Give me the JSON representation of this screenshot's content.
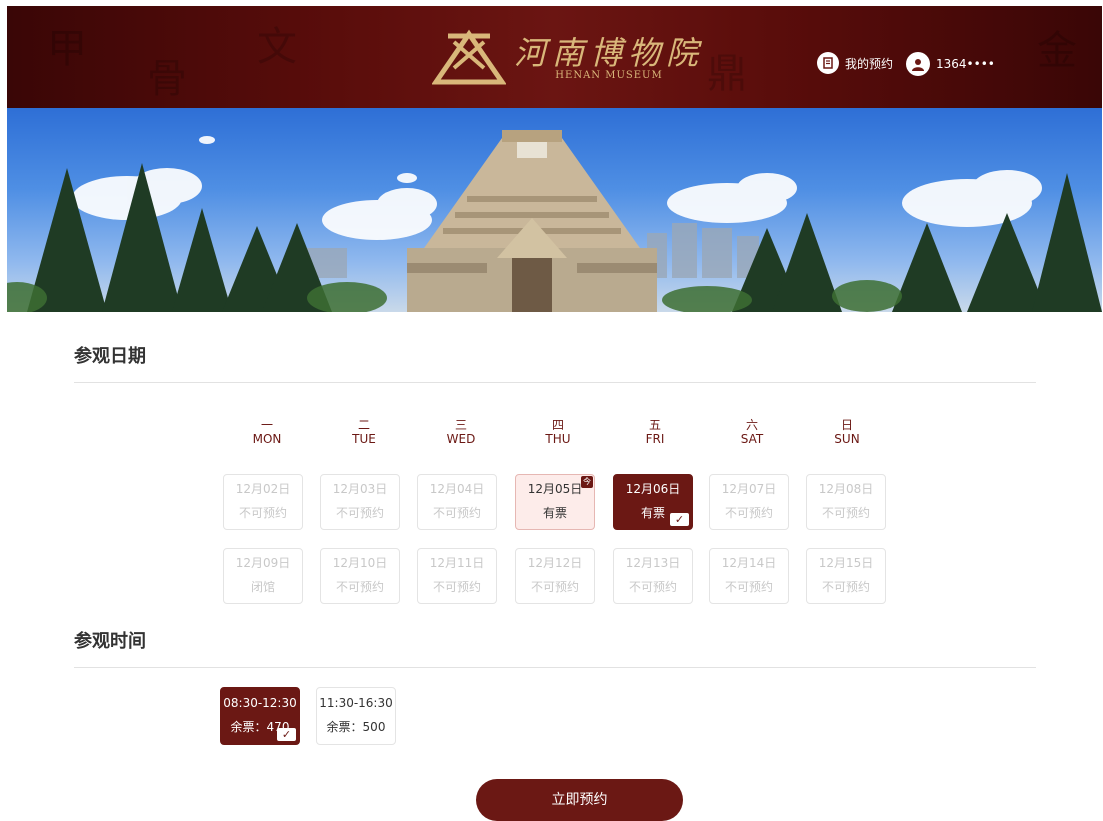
{
  "header": {
    "logo_cn": "河南博物院",
    "logo_en": "HENAN MUSEUM",
    "my_booking": "我的预约",
    "user": "1364••••",
    "icons": [
      "booking-icon",
      "user-icon"
    ],
    "background": "#5a0d0b"
  },
  "colors": {
    "accent": "#6b1814",
    "available_bg": "#fdecea",
    "muted": "#c8c8c8"
  },
  "date_section": {
    "title": "参观日期",
    "weekdays": [
      {
        "cn": "一",
        "en": "MON"
      },
      {
        "cn": "二",
        "en": "TUE"
      },
      {
        "cn": "三",
        "en": "WED"
      },
      {
        "cn": "四",
        "en": "THU"
      },
      {
        "cn": "五",
        "en": "FRI"
      },
      {
        "cn": "六",
        "en": "SAT"
      },
      {
        "cn": "日",
        "en": "SUN"
      }
    ],
    "week1": [
      {
        "date": "12月02日",
        "status": "不可预约"
      },
      {
        "date": "12月03日",
        "status": "不可预约"
      },
      {
        "date": "12月04日",
        "status": "不可预约"
      },
      {
        "date": "12月05日",
        "status": "有票",
        "today_tag": "今"
      },
      {
        "date": "12月06日",
        "status": "有票",
        "check": "✓"
      },
      {
        "date": "12月07日",
        "status": "不可预约"
      },
      {
        "date": "12月08日",
        "status": "不可预约"
      }
    ],
    "week2": [
      {
        "date": "12月09日",
        "status": "闭馆"
      },
      {
        "date": "12月10日",
        "status": "不可预约"
      },
      {
        "date": "12月11日",
        "status": "不可预约"
      },
      {
        "date": "12月12日",
        "status": "不可预约"
      },
      {
        "date": "12月13日",
        "status": "不可预约"
      },
      {
        "date": "12月14日",
        "status": "不可预约"
      },
      {
        "date": "12月15日",
        "status": "不可预约"
      }
    ]
  },
  "time_section": {
    "title": "参观时间",
    "slots": [
      {
        "time": "08:30-12:30",
        "remain": "余票：470",
        "check": "✓"
      },
      {
        "time": "11:30-16:30",
        "remain": "余票：500"
      }
    ]
  },
  "book_button": "立即预约"
}
